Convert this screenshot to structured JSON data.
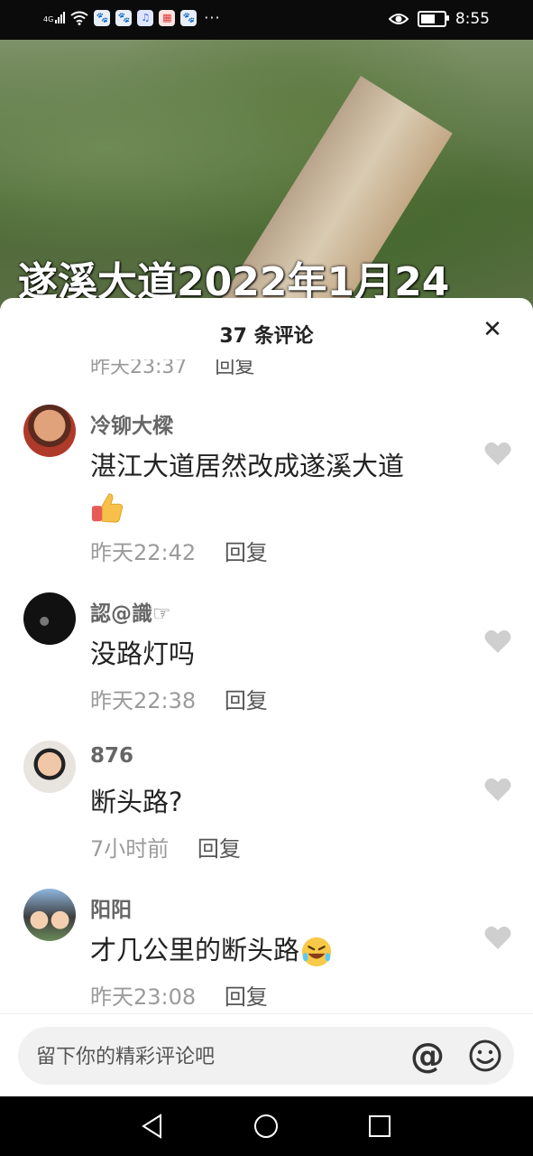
{
  "status_bar": {
    "network": "4G",
    "time": "8:55",
    "battery_level": 0.75,
    "notification_icons": [
      "baidu-icon",
      "baidu-icon",
      "music-icon",
      "gift-icon",
      "baidu-icon"
    ],
    "more": "···"
  },
  "video": {
    "caption": "遂溪大道2022年1月24"
  },
  "comments_sheet": {
    "title": "37 条评论",
    "peek_row": {
      "time": "昨天23:37",
      "reply": "回复"
    },
    "comments": [
      {
        "username": "冷铆大樑",
        "text": "湛江大道居然改成遂溪大道",
        "emoji": "thumbs-up-emoji",
        "time": "昨天22:42",
        "reply": "回复"
      },
      {
        "username": "認@識☞",
        "text": "没路灯吗",
        "time": "昨天22:38",
        "reply": "回复"
      },
      {
        "username": "876",
        "text": "断头路?",
        "time": "7小时前",
        "reply": "回复"
      },
      {
        "username": "阳阳",
        "text": "才几公里的断头路",
        "emoji": "rofl-emoji",
        "time": "昨天23:08",
        "reply": "回复"
      }
    ]
  },
  "comment_input": {
    "placeholder": "留下你的精彩评论吧",
    "at_symbol": "@"
  },
  "colors": {
    "sheet_bg": "#ffffff",
    "secondary_text": "#9b9b9b",
    "heart": "#cfcfcf"
  }
}
